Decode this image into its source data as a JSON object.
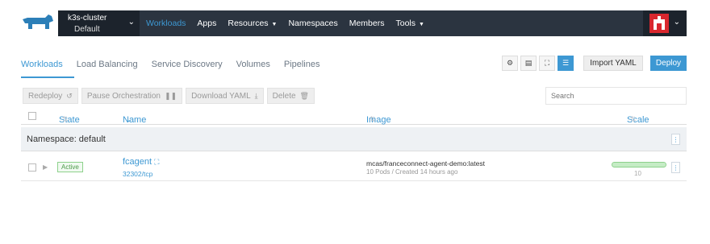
{
  "nav": {
    "cluster_name": "k3s-cluster",
    "project_name": "Default",
    "items": [
      {
        "label": "Workloads",
        "active": true,
        "dropdown": false
      },
      {
        "label": "Apps",
        "active": false,
        "dropdown": false
      },
      {
        "label": "Resources",
        "active": false,
        "dropdown": true
      },
      {
        "label": "Namespaces",
        "active": false,
        "dropdown": false
      },
      {
        "label": "Members",
        "active": false,
        "dropdown": false
      },
      {
        "label": "Tools",
        "active": false,
        "dropdown": true
      }
    ]
  },
  "tabs": [
    {
      "label": "Workloads",
      "active": true
    },
    {
      "label": "Load Balancing",
      "active": false
    },
    {
      "label": "Service Discovery",
      "active": false
    },
    {
      "label": "Volumes",
      "active": false
    },
    {
      "label": "Pipelines",
      "active": false
    }
  ],
  "view_buttons": [
    {
      "icon": "gear-icon",
      "glyph": "⚙",
      "active": false
    },
    {
      "icon": "list-icon",
      "glyph": "▤",
      "active": false
    },
    {
      "icon": "node-icon",
      "glyph": "⛶",
      "active": false
    },
    {
      "icon": "group-icon",
      "glyph": "☰",
      "active": true
    }
  ],
  "header_buttons": {
    "import_yaml": "Import YAML",
    "deploy": "Deploy"
  },
  "actions": [
    {
      "label": "Redeploy",
      "icon": "↺"
    },
    {
      "label": "Pause Orchestration",
      "icon": "❚❚"
    },
    {
      "label": "Download YAML",
      "icon": "⤓"
    },
    {
      "label": "Delete",
      "icon": "🗑"
    }
  ],
  "search": {
    "placeholder": "Search"
  },
  "table": {
    "columns": {
      "state": "State",
      "name": "Name",
      "image": "Image",
      "scale": "Scale"
    },
    "namespace_label": "Namespace: default",
    "rows": [
      {
        "state": "Active",
        "name": "fcagent",
        "port": "32302/tcp",
        "image": "mcas/franceconnect-agent-demo:latest",
        "meta": "10 Pods / Created 14 hours ago",
        "scale": "10",
        "scale_fraction": 1.0
      }
    ]
  },
  "colors": {
    "accent": "#3d98d3",
    "nav_bg": "#2b3440",
    "active_green": "#4c9a4a",
    "avatar": "#d9272e"
  }
}
